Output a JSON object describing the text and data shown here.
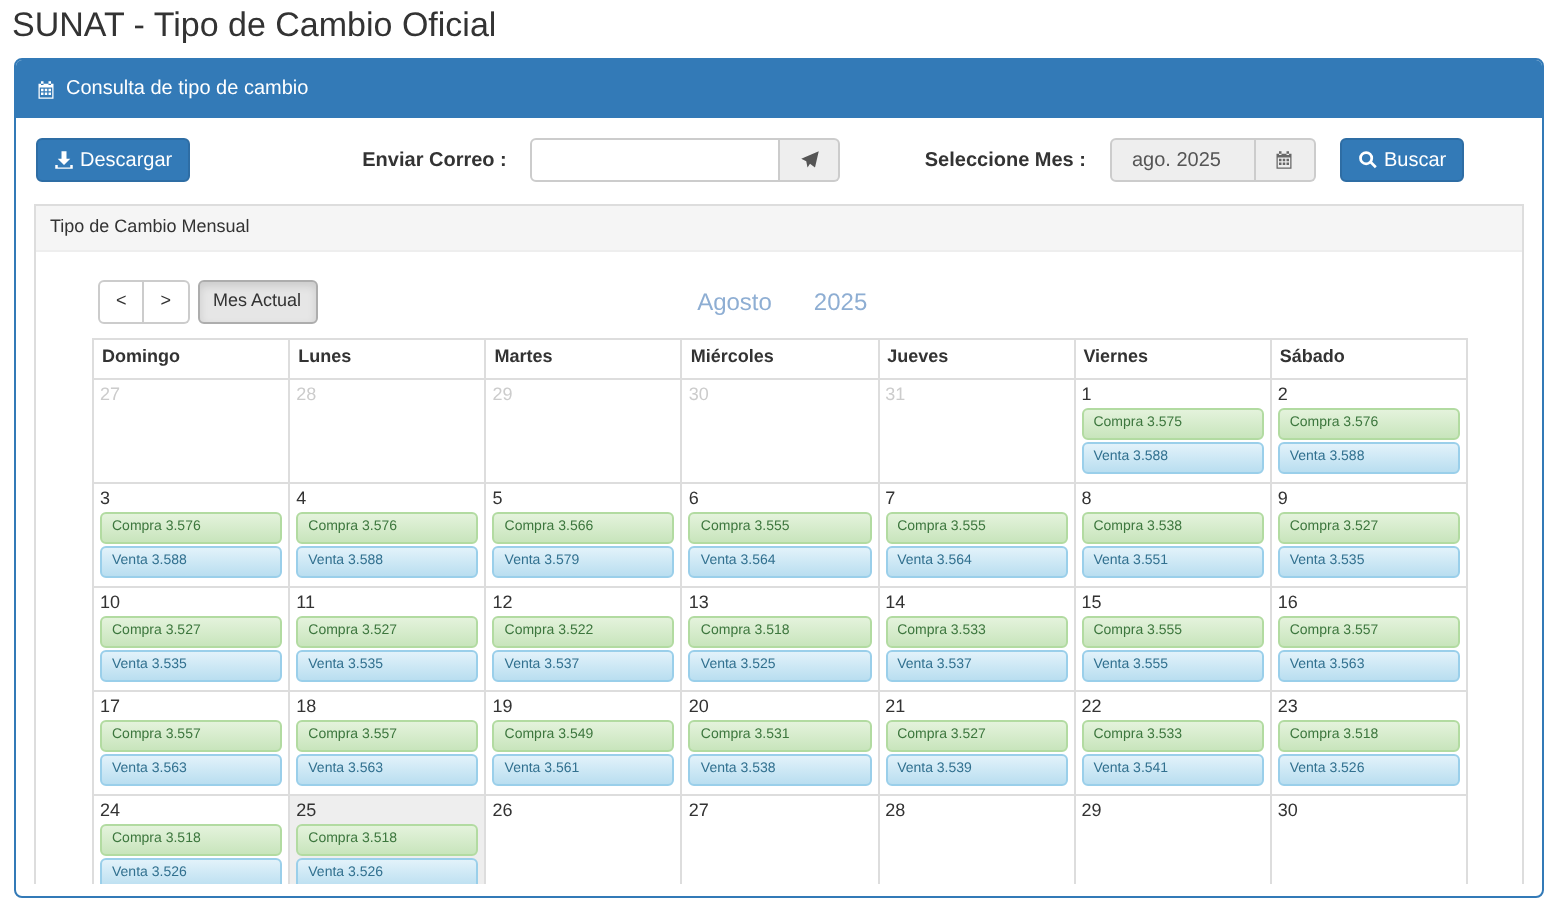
{
  "page_title": "SUNAT - Tipo de Cambio Oficial",
  "card": {
    "title": "Consulta de tipo de cambio"
  },
  "toolbar": {
    "download_button": "Descargar",
    "email_label": "Enviar Correo :",
    "month_label": "Seleccione Mes :",
    "month_field": {
      "value": "ago. 2025"
    },
    "search_button": "Buscar"
  },
  "panel": {
    "title": "Tipo de Cambio Mensual"
  },
  "calendar": {
    "prev": "<",
    "next": ">",
    "current_button": "Mes Actual",
    "month": "Agosto",
    "year": "2025",
    "weekdays": [
      "Domingo",
      "Lunes",
      "Martes",
      "Miércoles",
      "Jueves",
      "Viernes",
      "Sábado"
    ],
    "weeks": [
      [
        {
          "day": "27",
          "other_month": true,
          "today": false
        },
        {
          "day": "28",
          "other_month": true,
          "today": false
        },
        {
          "day": "29",
          "other_month": true,
          "today": false
        },
        {
          "day": "30",
          "other_month": true,
          "today": false
        },
        {
          "day": "31",
          "other_month": true,
          "today": false
        },
        {
          "day": "1",
          "other_month": false,
          "today": false,
          "buy": "Compra 3.575",
          "sell": "Venta 3.588"
        },
        {
          "day": "2",
          "other_month": false,
          "today": false,
          "buy": "Compra 3.576",
          "sell": "Venta 3.588"
        }
      ],
      [
        {
          "day": "3",
          "other_month": false,
          "today": false,
          "buy": "Compra 3.576",
          "sell": "Venta 3.588"
        },
        {
          "day": "4",
          "other_month": false,
          "today": false,
          "buy": "Compra 3.576",
          "sell": "Venta 3.588"
        },
        {
          "day": "5",
          "other_month": false,
          "today": false,
          "buy": "Compra 3.566",
          "sell": "Venta 3.579"
        },
        {
          "day": "6",
          "other_month": false,
          "today": false,
          "buy": "Compra 3.555",
          "sell": "Venta 3.564"
        },
        {
          "day": "7",
          "other_month": false,
          "today": false,
          "buy": "Compra 3.555",
          "sell": "Venta 3.564"
        },
        {
          "day": "8",
          "other_month": false,
          "today": false,
          "buy": "Compra 3.538",
          "sell": "Venta 3.551"
        },
        {
          "day": "9",
          "other_month": false,
          "today": false,
          "buy": "Compra 3.527",
          "sell": "Venta 3.535"
        }
      ],
      [
        {
          "day": "10",
          "other_month": false,
          "today": false,
          "buy": "Compra 3.527",
          "sell": "Venta 3.535"
        },
        {
          "day": "11",
          "other_month": false,
          "today": false,
          "buy": "Compra 3.527",
          "sell": "Venta 3.535"
        },
        {
          "day": "12",
          "other_month": false,
          "today": false,
          "buy": "Compra 3.522",
          "sell": "Venta 3.537"
        },
        {
          "day": "13",
          "other_month": false,
          "today": false,
          "buy": "Compra 3.518",
          "sell": "Venta 3.525"
        },
        {
          "day": "14",
          "other_month": false,
          "today": false,
          "buy": "Compra 3.533",
          "sell": "Venta 3.537"
        },
        {
          "day": "15",
          "other_month": false,
          "today": false,
          "buy": "Compra 3.555",
          "sell": "Venta 3.555"
        },
        {
          "day": "16",
          "other_month": false,
          "today": false,
          "buy": "Compra 3.557",
          "sell": "Venta 3.563"
        }
      ],
      [
        {
          "day": "17",
          "other_month": false,
          "today": false,
          "buy": "Compra 3.557",
          "sell": "Venta 3.563"
        },
        {
          "day": "18",
          "other_month": false,
          "today": false,
          "buy": "Compra 3.557",
          "sell": "Venta 3.563"
        },
        {
          "day": "19",
          "other_month": false,
          "today": false,
          "buy": "Compra 3.549",
          "sell": "Venta 3.561"
        },
        {
          "day": "20",
          "other_month": false,
          "today": false,
          "buy": "Compra 3.531",
          "sell": "Venta 3.538"
        },
        {
          "day": "21",
          "other_month": false,
          "today": false,
          "buy": "Compra 3.527",
          "sell": "Venta 3.539"
        },
        {
          "day": "22",
          "other_month": false,
          "today": false,
          "buy": "Compra 3.533",
          "sell": "Venta 3.541"
        },
        {
          "day": "23",
          "other_month": false,
          "today": false,
          "buy": "Compra 3.518",
          "sell": "Venta 3.526"
        }
      ],
      [
        {
          "day": "24",
          "other_month": false,
          "today": false,
          "buy": "Compra 3.518",
          "sell": "Venta 3.526"
        },
        {
          "day": "25",
          "other_month": false,
          "today": true,
          "buy": "Compra 3.518",
          "sell": "Venta 3.526"
        },
        {
          "day": "26",
          "other_month": false,
          "today": false
        },
        {
          "day": "27",
          "other_month": false,
          "today": false
        },
        {
          "day": "28",
          "other_month": false,
          "today": false
        },
        {
          "day": "29",
          "other_month": false,
          "today": false
        },
        {
          "day": "30",
          "other_month": false,
          "today": false
        }
      ]
    ]
  }
}
